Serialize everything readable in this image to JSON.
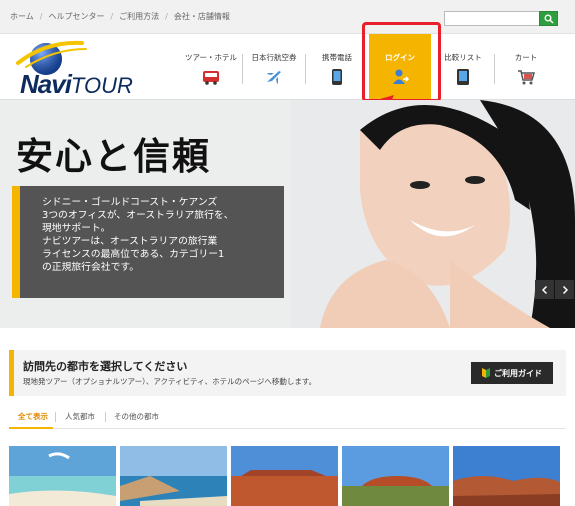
{
  "breadcrumbs": [
    "ホーム",
    "ヘルプセンター",
    "ご利用方法",
    "会社・店舗情報"
  ],
  "search": {
    "placeholder": "",
    "icon": "search-icon"
  },
  "logo": {
    "navi": "Navi",
    "tour": "TOUR"
  },
  "nav": {
    "items": [
      {
        "label": "ツアー・ホテル",
        "icon": "bus-icon"
      },
      {
        "label": "日本行航空券",
        "icon": "airplane-icon"
      },
      {
        "label": "携帯電話",
        "icon": "mobile-phone-icon"
      },
      {
        "label": "ログイン",
        "icon": "user-login-icon",
        "active": true
      },
      {
        "label": "比較リスト",
        "icon": "compare-list-icon"
      },
      {
        "label": "カート",
        "icon": "cart-icon"
      }
    ]
  },
  "hero": {
    "title": "安心と信頼",
    "lines": [
      "シドニー・ゴールドコースト・ケアンズ",
      "3つのオフィスが、オーストラリア旅行を、",
      "現地サポート。",
      "ナビツアーは、オーストラリアの旅行業",
      "ライセンスの最高位である、カテゴリー1",
      "の正規旅行会社です。"
    ],
    "prev": "‹",
    "next": "›"
  },
  "city": {
    "title": "訪問先の都市を選択してください",
    "subtitle": "現地発ツアー（オプショナルツアー）、アクティビティ、ホテルのページへ移動します。",
    "guide_label": "ご利用ガイド"
  },
  "tabs": [
    "全て表示",
    "人気都市",
    "その他の都市"
  ],
  "colors": {
    "accent": "#f5b400",
    "highlight": "#e8202a",
    "brand": "#0d2b5e"
  }
}
